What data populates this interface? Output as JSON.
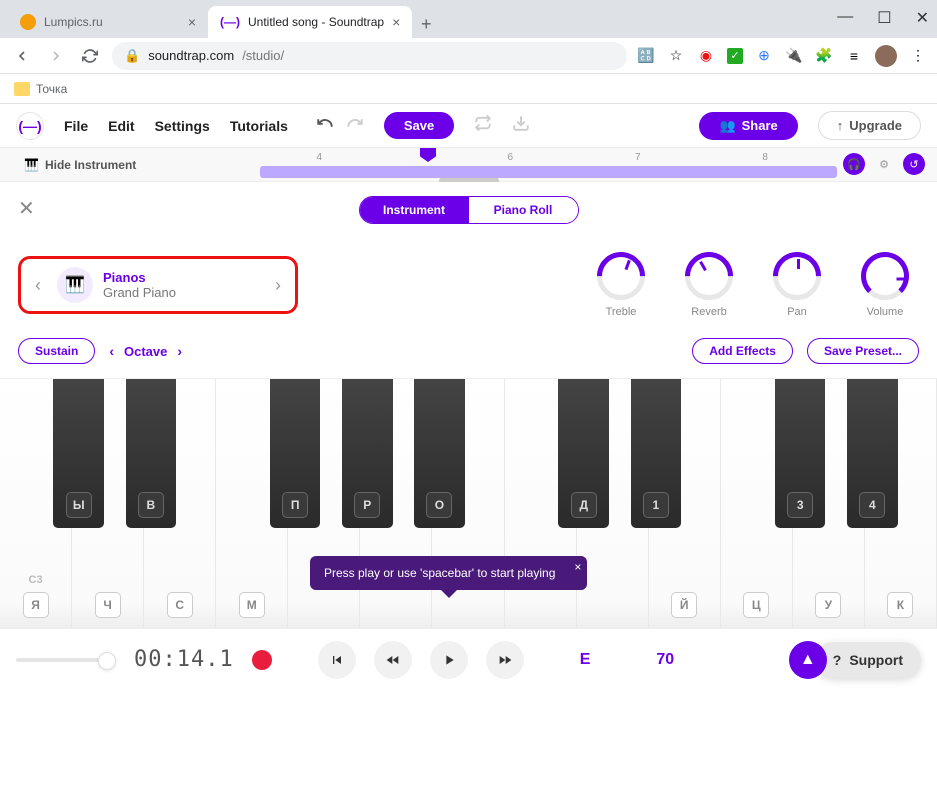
{
  "browser": {
    "tabs": [
      {
        "title": "Lumpics.ru",
        "active": false
      },
      {
        "title": "Untitled song - Soundtrap",
        "active": true
      }
    ],
    "url_domain": "soundtrap.com",
    "url_path": "/studio/",
    "bookmark": "Точка"
  },
  "header": {
    "menu": [
      "File",
      "Edit",
      "Settings",
      "Tutorials"
    ],
    "save": "Save",
    "share": "Share",
    "upgrade": "Upgrade"
  },
  "timeline": {
    "hide_instrument": "Hide Instrument",
    "markers": [
      "4",
      "6",
      "7",
      "8"
    ]
  },
  "panel": {
    "tabs": {
      "instrument": "Instrument",
      "piano_roll": "Piano Roll"
    },
    "instrument": {
      "category": "Pianos",
      "name": "Grand Piano"
    },
    "knobs": [
      "Treble",
      "Reverb",
      "Pan",
      "Volume"
    ],
    "sustain": "Sustain",
    "octave": "Octave",
    "add_effects": "Add Effects",
    "save_preset": "Save Preset..."
  },
  "piano": {
    "note_label": "C3",
    "white_labels": [
      "Я",
      "Ч",
      "С",
      "М",
      "",
      "",
      "",
      "",
      "",
      "Й",
      "Ц",
      "У",
      "К"
    ],
    "black": [
      {
        "pos": 5.7,
        "label": "Ы"
      },
      {
        "pos": 13.4,
        "label": "В"
      },
      {
        "pos": 28.8,
        "label": "П"
      },
      {
        "pos": 36.5,
        "label": "Р"
      },
      {
        "pos": 44.2,
        "label": "О"
      },
      {
        "pos": 59.6,
        "label": "Д"
      },
      {
        "pos": 67.3,
        "label": "1"
      },
      {
        "pos": 82.7,
        "label": "3"
      },
      {
        "pos": 90.4,
        "label": "4"
      }
    ]
  },
  "tooltip": "Press play or use 'spacebar' to start playing",
  "transport": {
    "time": "00:14.1",
    "key": "E",
    "tempo": "70",
    "support": "Support"
  }
}
